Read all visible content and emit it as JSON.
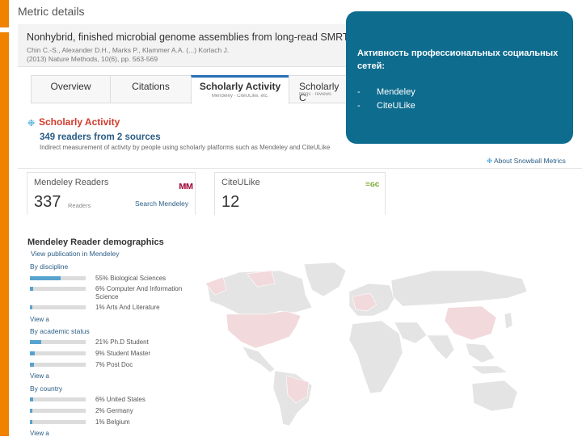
{
  "page": {
    "title": "Metric details"
  },
  "article": {
    "title": "Nonhybrid, finished microbial genome assemblies from long-read SMRT",
    "authors": "Chin C.-S., Alexander D.H., Marks P., Klammer A.A. (...) Korlach J.",
    "citation": "(2013) Nature Methods, 10(6), pp. 563-569"
  },
  "tabs": [
    {
      "label": "Overview",
      "sub": ""
    },
    {
      "label": "Citations",
      "sub": ""
    },
    {
      "label": "Scholarly Activity",
      "sub": "Mendeley · CiteULike, etc.",
      "active": true
    },
    {
      "label": "Scholarly C",
      "sub": "blogs · reviews"
    }
  ],
  "scholarly": {
    "title": "Scholarly Activity",
    "summary": "349 readers from 2 sources",
    "description": "Indirect measurement of activity by people using scholarly platforms such as Mendeley and CiteULike"
  },
  "overlay": {
    "title": "Активность профессиональных социальных сетей:",
    "items": [
      {
        "dash": "-",
        "text": "Mendeley"
      },
      {
        "dash": "-",
        "text": "CiteULike"
      }
    ]
  },
  "about_link": "About Snowball Metrics",
  "cards": {
    "mendeley": {
      "label": "Mendeley Readers",
      "value": "337",
      "unit": "Readers",
      "link": "Search Mendeley",
      "logo": "mendeley-logo"
    },
    "citeulike": {
      "label": "CiteULike",
      "value": "12",
      "logo": "citeulike-logo"
    }
  },
  "demographics": {
    "title": "Mendeley Reader demographics",
    "view_link": "View publication in Mendeley",
    "view_all": "View a",
    "sections": [
      {
        "heading": "By discipline",
        "rows": [
          {
            "pct_text": "55%",
            "label": "Biological Sciences",
            "fraction": 0.55
          },
          {
            "pct_text": "6%",
            "label": "Computer And Information Science",
            "fraction": 0.06
          },
          {
            "pct_text": "1%",
            "label": "Arts And Literature",
            "fraction": 0.01
          }
        ]
      },
      {
        "heading": "By academic status",
        "rows": [
          {
            "pct_text": "21%",
            "label": "Ph.D Student",
            "fraction": 0.21
          },
          {
            "pct_text": "9%",
            "label": "Student Master",
            "fraction": 0.09
          },
          {
            "pct_text": "7%",
            "label": "Post Doc",
            "fraction": 0.07
          }
        ]
      },
      {
        "heading": "By country",
        "rows": [
          {
            "pct_text": "6%",
            "label": "United States",
            "fraction": 0.06
          },
          {
            "pct_text": "2%",
            "label": "Germany",
            "fraction": 0.02
          },
          {
            "pct_text": "1%",
            "label": "Belgium",
            "fraction": 0.01
          }
        ]
      }
    ]
  },
  "colors": {
    "accent_orange": "#f08200",
    "overlay_teal": "#0e6c8f",
    "link_blue": "#2a5d86",
    "bar_blue": "#57a3cf",
    "title_red": "#d03b2a"
  }
}
